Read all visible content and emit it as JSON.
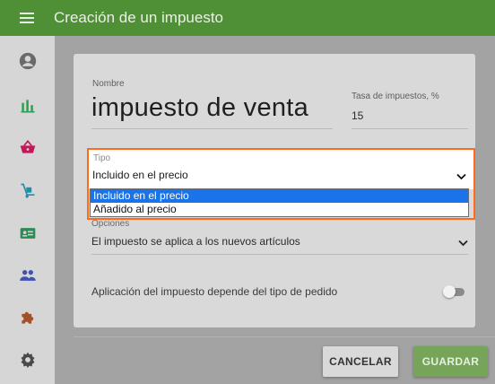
{
  "appbar": {
    "title": "Creación de un impuesto"
  },
  "sidebar": {
    "items": [
      {
        "name": "account-icon",
        "color": "#6a6a6a"
      },
      {
        "name": "bar-chart-icon",
        "color": "#2f9e55"
      },
      {
        "name": "basket-icon",
        "color": "#c2185b"
      },
      {
        "name": "hand-truck-icon",
        "color": "#1e8fa8"
      },
      {
        "name": "id-card-icon",
        "color": "#2e8b57"
      },
      {
        "name": "people-icon",
        "color": "#3f51b5"
      },
      {
        "name": "puzzle-icon",
        "color": "#a0522d"
      },
      {
        "name": "gear-icon",
        "color": "#4a4a4a"
      }
    ]
  },
  "form": {
    "name_label": "Nombre",
    "name_value": "impuesto de venta",
    "rate_label": "Tasa de impuestos, %",
    "rate_value": "15",
    "tipo_label": "Tipo",
    "tipo_value": "Incluido en el precio",
    "tipo_options": [
      "Incluido en el precio",
      "Añadido al precio"
    ],
    "opciones_label": "Opciones",
    "opciones_value": "El impuesto se aplica a los nuevos artículos",
    "dependent_label": "Aplicación del impuesto depende del tipo de pedido",
    "dependent_enabled": false
  },
  "actions": {
    "cancel_label": "CANCELAR",
    "save_label": "GUARDAR"
  },
  "colors": {
    "accent": "#4f8f36",
    "highlight": "#ff6b1a",
    "selected_option": "#1a73e8"
  }
}
